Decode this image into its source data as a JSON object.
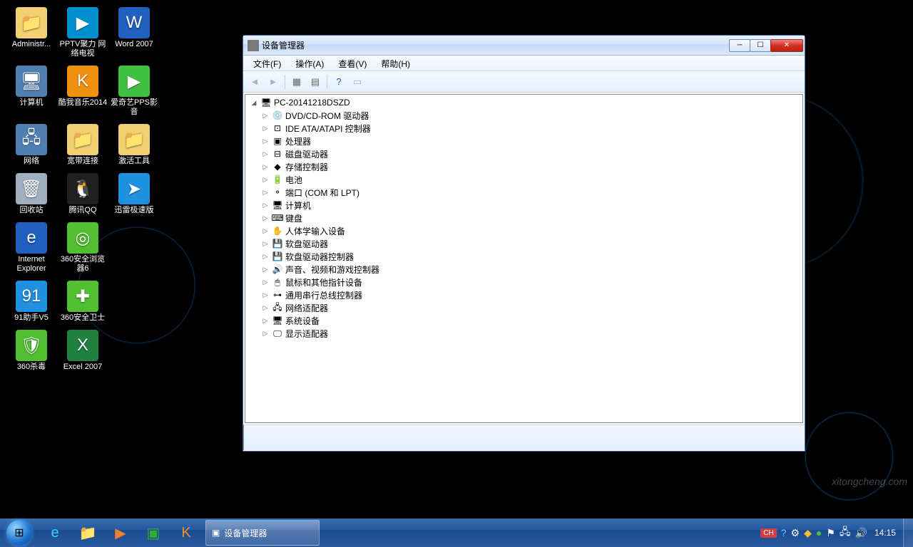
{
  "desktop_icons": [
    {
      "label": "Administr...",
      "bg": "#f0d070",
      "glyph": "📁"
    },
    {
      "label": "PPTV聚力 网络电视",
      "bg": "#0090d0",
      "glyph": "▶"
    },
    {
      "label": "Word 2007",
      "bg": "#2060c0",
      "glyph": "W"
    },
    {
      "label": "计算机",
      "bg": "#5080b0",
      "glyph": "🖥"
    },
    {
      "label": "酷我音乐2014",
      "bg": "#f09010",
      "glyph": "K"
    },
    {
      "label": "爱奇艺PPS影音",
      "bg": "#40c040",
      "glyph": "▶"
    },
    {
      "label": "网络",
      "bg": "#5080b0",
      "glyph": "🖧"
    },
    {
      "label": "宽带连接",
      "bg": "#f0d070",
      "glyph": "📁"
    },
    {
      "label": "激活工具",
      "bg": "#f0d070",
      "glyph": "📁"
    },
    {
      "label": "回收站",
      "bg": "#a0b0c0",
      "glyph": "🗑"
    },
    {
      "label": "腾讯QQ",
      "bg": "#202020",
      "glyph": "🐧"
    },
    {
      "label": "迅雷极速版",
      "bg": "#2090e0",
      "glyph": "➤"
    },
    {
      "label": "Internet Explorer",
      "bg": "#2060c0",
      "glyph": "e"
    },
    {
      "label": "360安全浏览器6",
      "bg": "#50c030",
      "glyph": "◎"
    },
    {
      "label": "",
      "bg": "transparent",
      "glyph": ""
    },
    {
      "label": "91助手V5",
      "bg": "#2090e0",
      "glyph": "91"
    },
    {
      "label": "360安全卫士",
      "bg": "#50c030",
      "glyph": "✚"
    },
    {
      "label": "",
      "bg": "transparent",
      "glyph": ""
    },
    {
      "label": "360杀毒",
      "bg": "#50c030",
      "glyph": "🛡"
    },
    {
      "label": "Excel 2007",
      "bg": "#208040",
      "glyph": "X"
    }
  ],
  "window": {
    "title": "设备管理器",
    "menu": [
      "文件(F)",
      "操作(A)",
      "查看(V)",
      "帮助(H)"
    ],
    "root": "PC-20141218DSZD",
    "categories": [
      {
        "label": "DVD/CD-ROM 驱动器",
        "glyph": "💿"
      },
      {
        "label": "IDE ATA/ATAPI 控制器",
        "glyph": "⊡"
      },
      {
        "label": "处理器",
        "glyph": "▣"
      },
      {
        "label": "磁盘驱动器",
        "glyph": "⊟"
      },
      {
        "label": "存储控制器",
        "glyph": "◆"
      },
      {
        "label": "电池",
        "glyph": "🔋"
      },
      {
        "label": "端口 (COM 和 LPT)",
        "glyph": "⚬"
      },
      {
        "label": "计算机",
        "glyph": "🖥"
      },
      {
        "label": "键盘",
        "glyph": "⌨"
      },
      {
        "label": "人体学输入设备",
        "glyph": "✋"
      },
      {
        "label": "软盘驱动器",
        "glyph": "💾"
      },
      {
        "label": "软盘驱动器控制器",
        "glyph": "💾"
      },
      {
        "label": "声音、视频和游戏控制器",
        "glyph": "🔊"
      },
      {
        "label": "鼠标和其他指针设备",
        "glyph": "🖱"
      },
      {
        "label": "通用串行总线控制器",
        "glyph": "⊶"
      },
      {
        "label": "网络适配器",
        "glyph": "🖧"
      },
      {
        "label": "系统设备",
        "glyph": "🖥"
      },
      {
        "label": "显示适配器",
        "glyph": "🖵"
      }
    ]
  },
  "taskbar": {
    "pinned": [
      {
        "glyph": "e",
        "color": "#3bd0ff"
      },
      {
        "glyph": "📁",
        "color": "#f0d060"
      },
      {
        "glyph": "▶",
        "color": "#f08030"
      },
      {
        "glyph": "▣",
        "color": "#30b030"
      },
      {
        "glyph": "K",
        "color": "#f09020"
      }
    ],
    "active_label": "设备管理器",
    "ime": "CH",
    "clock": "14:15"
  },
  "watermark": "xitongcheng.com"
}
